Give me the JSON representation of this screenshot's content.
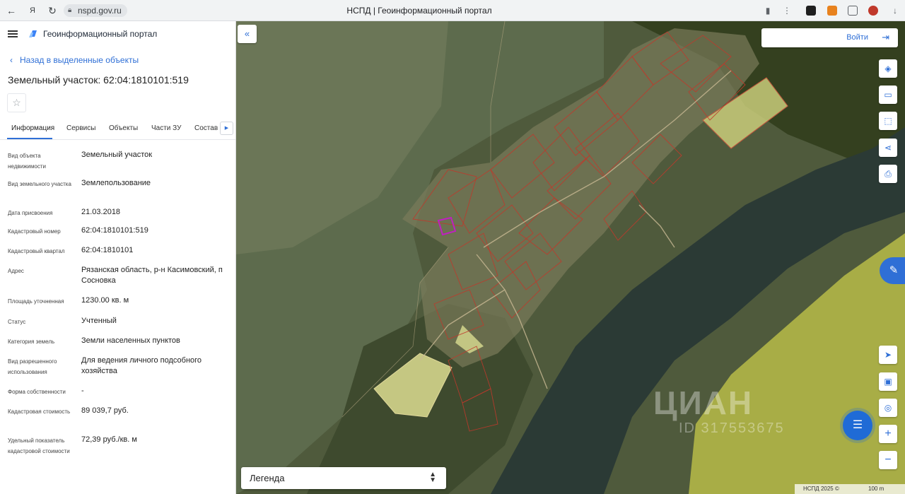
{
  "browser": {
    "url": "nspd.gov.ru",
    "tab_title": "НСПД | Геоинформационный портал"
  },
  "panel": {
    "brand": "Геоинформационный портал",
    "back_link": "Назад в выделенные объекты",
    "title": "Земельный участок: 62:04:1810101:519",
    "tabs": [
      {
        "label": "Информация",
        "active": true
      },
      {
        "label": "Сервисы"
      },
      {
        "label": "Объекты"
      },
      {
        "label": "Части ЗУ"
      },
      {
        "label": "Состав"
      }
    ],
    "fields": [
      {
        "label": "Вид объекта недвижимости",
        "value": "Земельный участок"
      },
      {
        "label": "Вид земельного участка",
        "value": "Землепользование"
      },
      {
        "label": "Дата присвоения",
        "value": "21.03.2018"
      },
      {
        "label": "Кадастровый номер",
        "value": "62:04:1810101:519"
      },
      {
        "label": "Кадастровый квартал",
        "value": "62:04:1810101"
      },
      {
        "label": "Адрес",
        "value": "Рязанская область, р-н Касимовский, п Сосновка"
      },
      {
        "label": "Площадь уточненная",
        "value": "1230.00 кв. м"
      },
      {
        "label": "Статус",
        "value": "Учтенный"
      },
      {
        "label": "Категория земель",
        "value": "Земли населенных пунктов"
      },
      {
        "label": "Вид разрешенного использования",
        "value": "Для ведения личного подсобного хозяйства"
      },
      {
        "label": "Форма собственности",
        "value": "-"
      },
      {
        "label": "Кадастровая стоимость",
        "value": "89 039,7 руб."
      },
      {
        "label": "Удельный показатель кадастровой стоимости",
        "value": "72,39 руб./кв. м"
      }
    ]
  },
  "map": {
    "login_label": "Войти",
    "legend_label": "Легенда",
    "watermark_brand": "ЦИАН",
    "watermark_id": "ID 317553675",
    "copyright": "НСПД 2025 ©",
    "scale": "100 m"
  },
  "colors": {
    "accent": "#2f6fd6",
    "parcel_outline": "#c0392b",
    "selected_parcel": "#c020c0"
  }
}
